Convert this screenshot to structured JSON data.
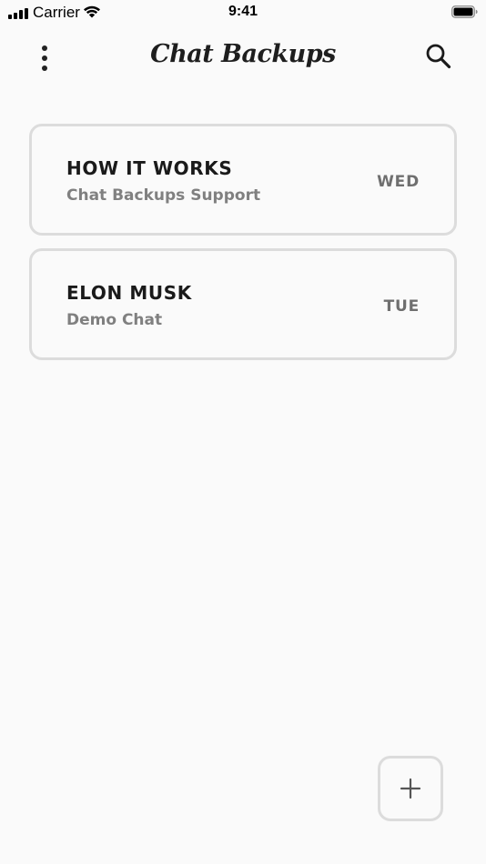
{
  "status_bar": {
    "carrier": "Carrier",
    "time": "9:41",
    "icons": [
      "cellular-signal-icon",
      "wifi-icon",
      "battery-icon"
    ]
  },
  "header": {
    "title": "Chat Backups",
    "left_icon": "more-vertical-icon",
    "right_icon": "search-icon"
  },
  "chats": [
    {
      "title": "HOW IT WORKS",
      "subtitle": "Chat Backups Support",
      "day": "WED"
    },
    {
      "title": "ELON MUSK",
      "subtitle": "Demo Chat",
      "day": "TUE"
    }
  ],
  "fab": {
    "icon": "plus-icon"
  },
  "colors": {
    "background": "#fafafa",
    "card_border": "#dcdcdc",
    "title_text": "#1a1a1a",
    "subtitle_text": "#808080",
    "day_text": "#6f6f6f"
  }
}
